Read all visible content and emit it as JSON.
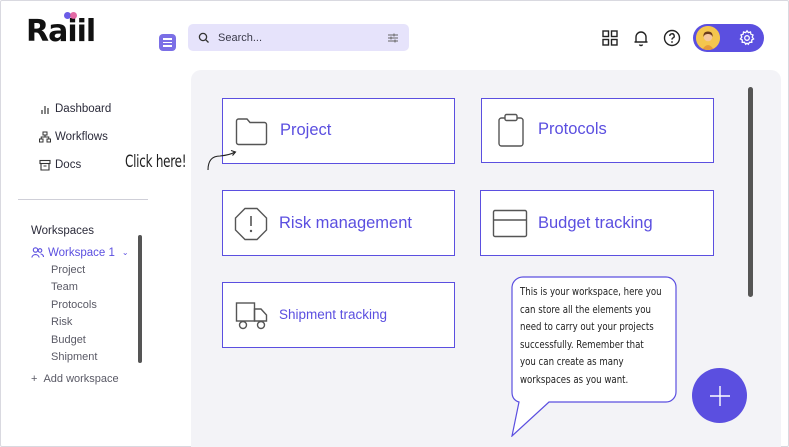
{
  "app": {
    "logo_text": "Raiil"
  },
  "search": {
    "placeholder": "Search..."
  },
  "sidebar": {
    "items": [
      {
        "label": "Dashboard",
        "icon": "bar-chart-icon"
      },
      {
        "label": "Workflows",
        "icon": "workflow-icon"
      },
      {
        "label": "Docs",
        "icon": "archive-icon"
      }
    ],
    "workspaces_title": "Workspaces",
    "active_workspace": "Workspace 1",
    "workspace_children": [
      "Project",
      "Team",
      "Protocols",
      "Risk",
      "Budget",
      "Shipment"
    ],
    "add_workspace": "Add workspace"
  },
  "annotation": {
    "click_here": "Click here!",
    "bubble_lines": [
      "This is your workspace, here you",
      "can store all the elements you",
      "need to carry out your projects",
      "successfully. Remember that",
      "you can create as many",
      "workspaces as you want."
    ]
  },
  "cards": [
    {
      "label": "Project",
      "icon": "folder-icon"
    },
    {
      "label": "Protocols",
      "icon": "clipboard-icon"
    },
    {
      "label": "Risk management",
      "icon": "warning-octagon-icon"
    },
    {
      "label": "Budget tracking",
      "icon": "card-icon"
    },
    {
      "label": "Shipment tracking",
      "icon": "truck-icon"
    }
  ],
  "colors": {
    "accent": "#5b4fe0",
    "search_bg": "#e6e3fb",
    "main_bg": "#f3f3f7"
  }
}
